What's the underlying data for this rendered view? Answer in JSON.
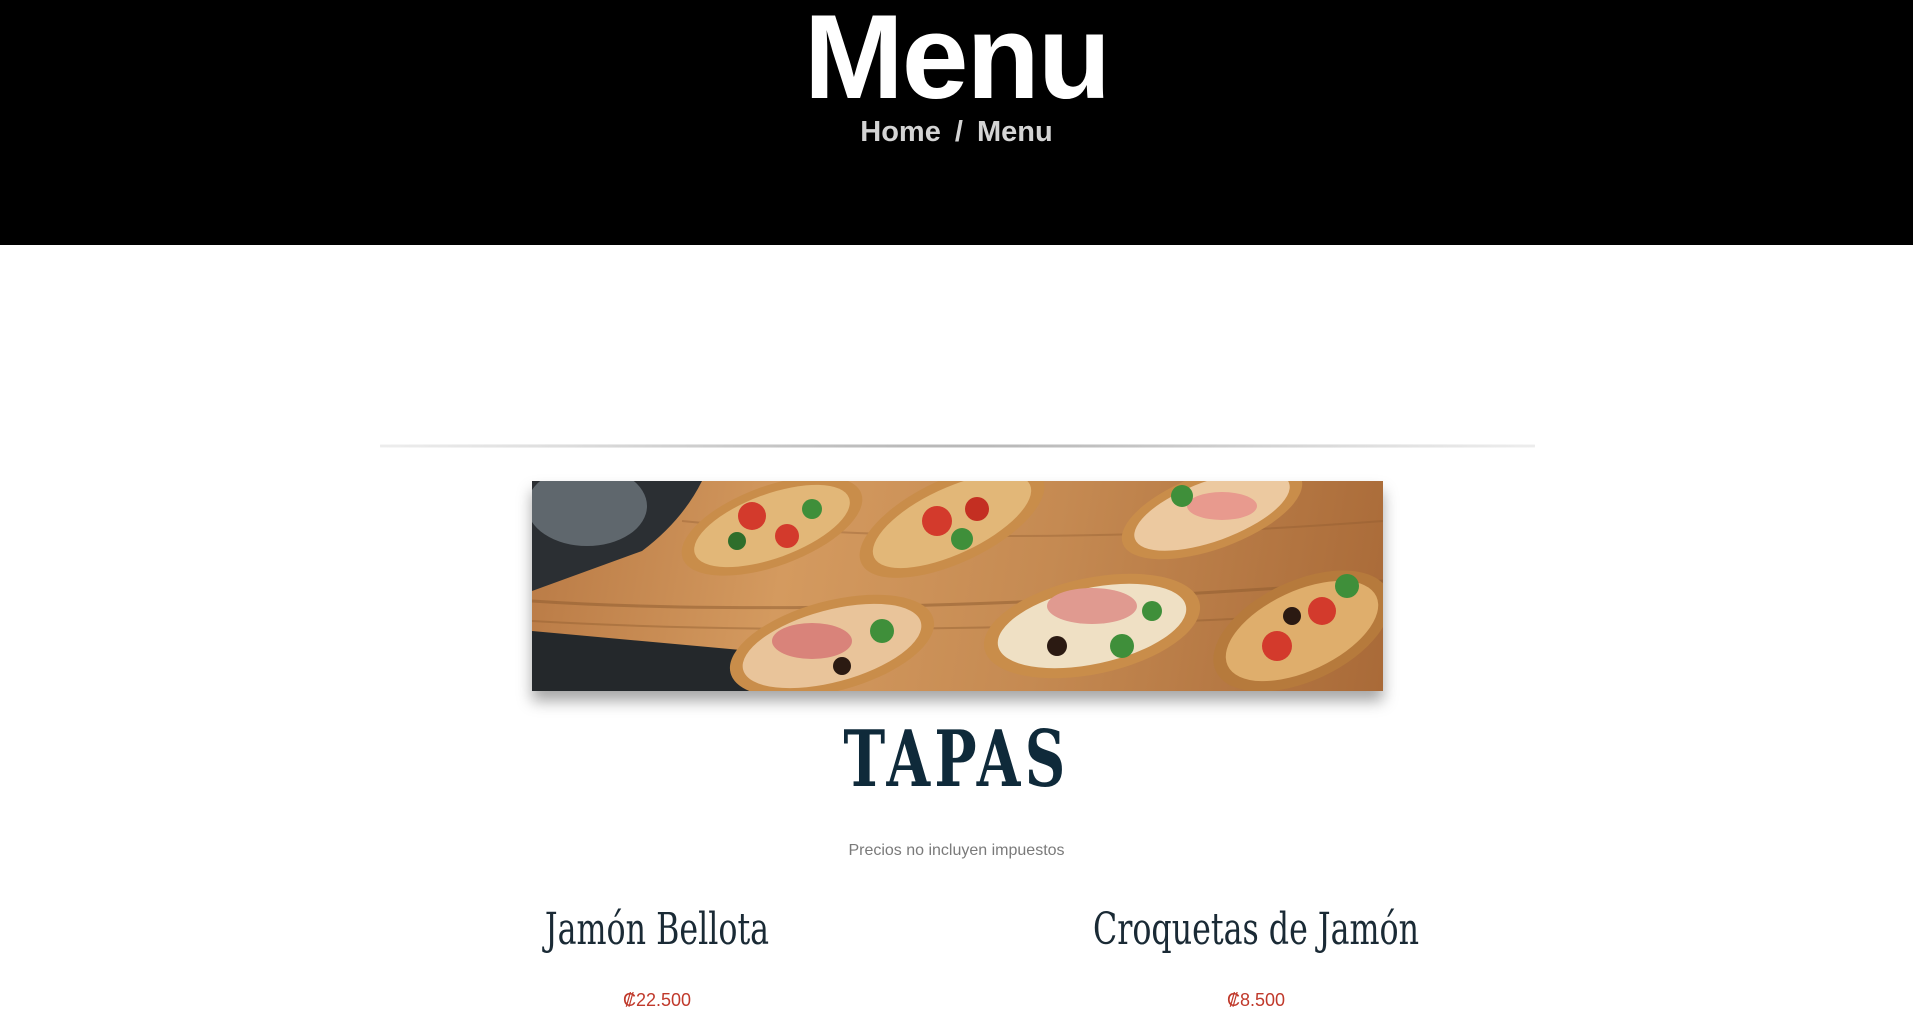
{
  "hero": {
    "title": "Menu",
    "breadcrumb": {
      "home": "Home",
      "separator": "/",
      "current": "Menu"
    }
  },
  "section": {
    "title": "TAPAS",
    "note": "Precios no incluyen impuestos",
    "banner_alt": "Bruschetta tapas platter"
  },
  "items": [
    {
      "name": "Jamón Bellota",
      "price": "₡22.500"
    },
    {
      "name": "Croquetas de Jamón",
      "price": "₡8.500"
    }
  ],
  "colors": {
    "hero_bg": "#000000",
    "title_color": "#ffffff",
    "breadcrumb_color": "#d4d4d4",
    "heading_color": "#0f2a3a",
    "price_color": "#c0392b"
  }
}
